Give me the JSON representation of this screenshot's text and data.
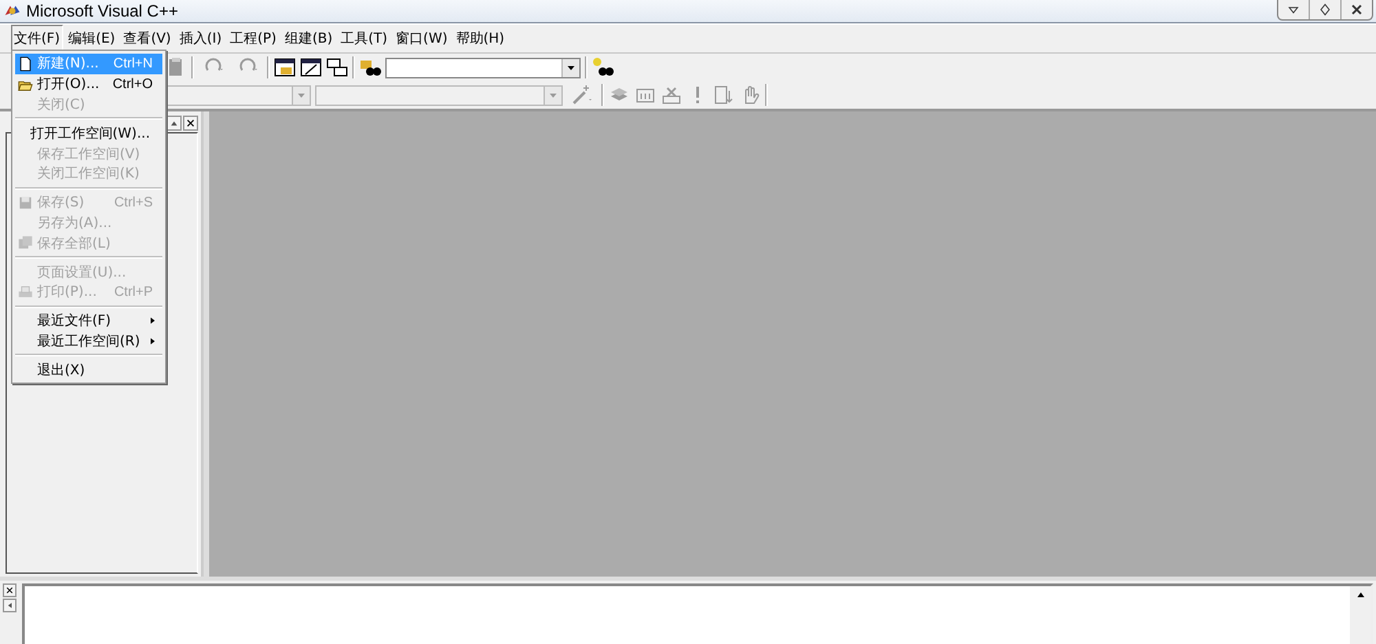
{
  "window": {
    "title": "Microsoft Visual C++"
  },
  "menubar": [
    {
      "label": "文件(F)",
      "selected": true
    },
    {
      "label": "编辑(E)",
      "selected": false
    },
    {
      "label": "查看(V)",
      "selected": false
    },
    {
      "label": "插入(I)",
      "selected": false
    },
    {
      "label": "工程(P)",
      "selected": false
    },
    {
      "label": "组建(B)",
      "selected": false
    },
    {
      "label": "工具(T)",
      "selected": false
    },
    {
      "label": "窗口(W)",
      "selected": false
    },
    {
      "label": "帮助(H)",
      "selected": false
    }
  ],
  "file_menu": [
    {
      "kind": "new",
      "label": "新建(N)...",
      "shortcut": "Ctrl+N",
      "disabled": false,
      "selected": true,
      "submenu": false
    },
    {
      "kind": "open",
      "label": "打开(O)...",
      "shortcut": "Ctrl+O",
      "disabled": false,
      "selected": false,
      "submenu": false
    },
    {
      "kind": "item",
      "label": "关闭(C)",
      "disabled": true,
      "selected": false,
      "submenu": false
    },
    {
      "kind": "separator"
    },
    {
      "kind": "item",
      "label": "打开工作空间(W)...",
      "disabled": false,
      "selected": false,
      "submenu": false
    },
    {
      "kind": "item",
      "label": "保存工作空间(V)",
      "disabled": true,
      "selected": false,
      "submenu": false
    },
    {
      "kind": "item",
      "label": "关闭工作空间(K)",
      "disabled": true,
      "selected": false,
      "submenu": false
    },
    {
      "kind": "separator"
    },
    {
      "kind": "save",
      "label": "保存(S)",
      "shortcut": "Ctrl+S",
      "disabled": true,
      "selected": false,
      "submenu": false
    },
    {
      "kind": "item",
      "label": "另存为(A)...",
      "disabled": true,
      "selected": false,
      "submenu": false
    },
    {
      "kind": "saveall",
      "label": "保存全部(L)",
      "disabled": true,
      "selected": false,
      "submenu": false
    },
    {
      "kind": "separator"
    },
    {
      "kind": "item",
      "label": "页面设置(U)...",
      "disabled": true,
      "selected": false,
      "submenu": false
    },
    {
      "kind": "print",
      "label": "打印(P)...",
      "shortcut": "Ctrl+P",
      "disabled": true,
      "selected": false,
      "submenu": false
    },
    {
      "kind": "separator"
    },
    {
      "kind": "item",
      "label": "最近文件(F)",
      "disabled": false,
      "selected": false,
      "submenu": true
    },
    {
      "kind": "item",
      "label": "最近工作空间(R)",
      "disabled": false,
      "selected": false,
      "submenu": true
    },
    {
      "kind": "separator"
    },
    {
      "kind": "item",
      "label": "退出(X)",
      "disabled": false,
      "selected": false,
      "submenu": false
    }
  ]
}
